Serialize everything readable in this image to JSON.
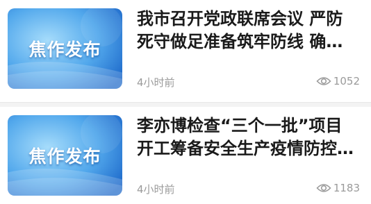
{
  "articles": [
    {
      "thumbnail_text": "焦作发布",
      "title": "我市召开党政联席会议 严防死守做足准备筑牢防线 确保人…",
      "time": "4小时前",
      "views": "1052"
    },
    {
      "thumbnail_text": "焦作发布",
      "title": "李亦博检查“三个一批”项目开工筹备安全生产疫情防控市…",
      "time": "4小时前",
      "views": "1183"
    }
  ],
  "colors": {
    "thumb_light": "#7fc9f7",
    "thumb_dark": "#1e6fd0",
    "meta": "#9a9a9a"
  }
}
